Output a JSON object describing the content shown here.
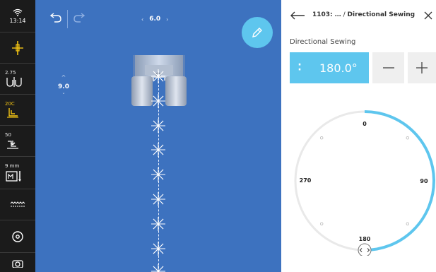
{
  "status": {
    "time": "13:14",
    "wifi_icon": "wifi-icon"
  },
  "toolbar": {
    "width_value": "2.75",
    "presser_foot": "20C",
    "tension_value": "50",
    "length_value": "9 mm"
  },
  "canvas": {
    "stitch_length": "6.0",
    "stitch_width": "9.0",
    "length_dec": "‹",
    "length_inc": "›",
    "width_inc": "^",
    "width_dec": "ˇ"
  },
  "panel": {
    "breadcrumb_id": "1103: …",
    "breadcrumb_sep": " / ",
    "breadcrumb_current": "Directional Sewing",
    "title": "Directional Sewing",
    "angle": "180.0°",
    "dial_labels": {
      "top": "0",
      "right": "90",
      "bottom": "180",
      "left": "270"
    }
  },
  "dial": {
    "angle_deg": 180,
    "accent": "#5ec6ee",
    "track": "#e9e9e9"
  },
  "colors": {
    "canvas_blue": "#3d72bf",
    "accent": "#5ec6ee",
    "toolbar": "#1b1b1b",
    "yellow": "#f3c414"
  }
}
